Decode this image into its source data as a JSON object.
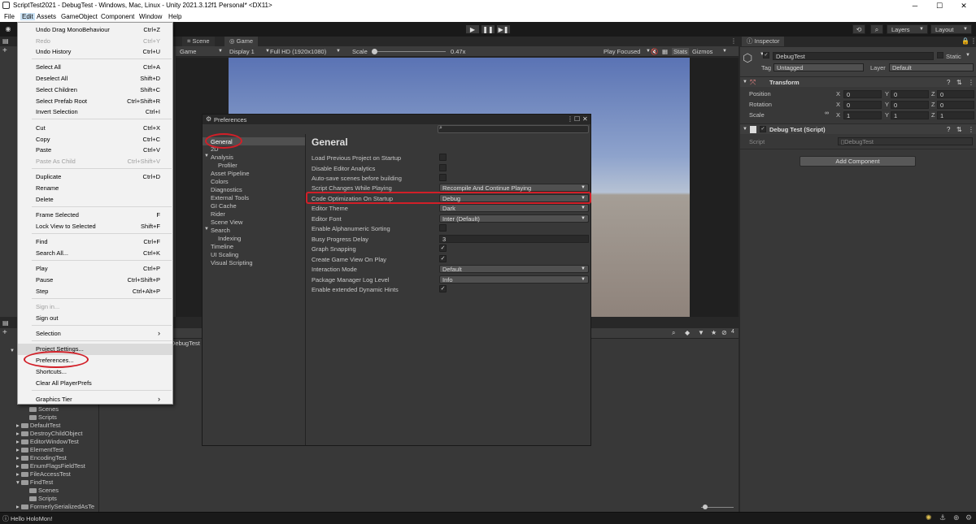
{
  "window": {
    "title": "ScriptTest2021 - DebugTest - Windows, Mac, Linux - Unity 2021.3.12f1 Personal* <DX11>",
    "minimize": "─",
    "maximize": "☐",
    "close": "✕"
  },
  "menubar": [
    "File",
    "Edit",
    "Assets",
    "GameObject",
    "Component",
    "Window",
    "Help"
  ],
  "edit_menu": {
    "items": [
      {
        "label": "Undo Drag MonoBehaviour",
        "shortcut": "Ctrl+Z"
      },
      {
        "label": "Redo",
        "shortcut": "Ctrl+Y",
        "disabled": true
      },
      {
        "label": "Undo History",
        "shortcut": "Ctrl+U"
      },
      {
        "label": "Select All",
        "shortcut": "Ctrl+A"
      },
      {
        "label": "Deselect All",
        "shortcut": "Shift+D"
      },
      {
        "label": "Select Children",
        "shortcut": "Shift+C"
      },
      {
        "label": "Select Prefab Root",
        "shortcut": "Ctrl+Shift+R"
      },
      {
        "label": "Invert Selection",
        "shortcut": "Ctrl+I"
      },
      {
        "label": "Cut",
        "shortcut": "Ctrl+X"
      },
      {
        "label": "Copy",
        "shortcut": "Ctrl+C"
      },
      {
        "label": "Paste",
        "shortcut": "Ctrl+V"
      },
      {
        "label": "Paste As Child",
        "shortcut": "Ctrl+Shift+V",
        "disabled": true
      },
      {
        "label": "Duplicate",
        "shortcut": "Ctrl+D"
      },
      {
        "label": "Rename",
        "shortcut": ""
      },
      {
        "label": "Delete",
        "shortcut": ""
      },
      {
        "label": "Frame Selected",
        "shortcut": "F"
      },
      {
        "label": "Lock View to Selected",
        "shortcut": "Shift+F"
      },
      {
        "label": "Find",
        "shortcut": "Ctrl+F"
      },
      {
        "label": "Search All...",
        "shortcut": "Ctrl+K"
      },
      {
        "label": "Play",
        "shortcut": "Ctrl+P"
      },
      {
        "label": "Pause",
        "shortcut": "Ctrl+Shift+P"
      },
      {
        "label": "Step",
        "shortcut": "Ctrl+Alt+P"
      },
      {
        "label": "Sign in...",
        "shortcut": "",
        "disabled": true
      },
      {
        "label": "Sign out",
        "shortcut": ""
      },
      {
        "label": "Selection",
        "shortcut": "›"
      },
      {
        "label": "Project Settings...",
        "shortcut": ""
      },
      {
        "label": "Preferences...",
        "shortcut": ""
      },
      {
        "label": "Shortcuts...",
        "shortcut": ""
      },
      {
        "label": "Clear All PlayerPrefs",
        "shortcut": ""
      },
      {
        "label": "Graphics Tier",
        "shortcut": "›"
      }
    ]
  },
  "toolbar": {
    "play": "▶",
    "pause": "❚❚",
    "step": "▶❚",
    "layers": "Layers",
    "layout": "Layout"
  },
  "scene_tabs": {
    "scene": "Scene",
    "game": "Game"
  },
  "game_bar": {
    "mode": "Game",
    "display": "Display 1",
    "resolution": "Full HD (1920x1080)",
    "scale_label": "Scale",
    "scale_value": "0.47x",
    "play_focused": "Play Focused",
    "stats": "Stats",
    "gizmos": "Gizmos"
  },
  "inspector": {
    "tab": "Inspector",
    "object_name": "DebugTest",
    "static_label": "Static",
    "tag_label": "Tag",
    "tag_value": "Untagged",
    "layer_label": "Layer",
    "layer_value": "Default",
    "transform_title": "Transform",
    "position_label": "Position",
    "rotation_label": "Rotation",
    "scale_label": "Scale",
    "axis_x": "X",
    "axis_y": "Y",
    "axis_z": "Z",
    "pos": [
      "0",
      "0",
      "0"
    ],
    "rot": [
      "0",
      "0",
      "0"
    ],
    "scl": [
      "1",
      "1",
      "1"
    ],
    "script_title": "Debug Test (Script)",
    "script_label": "Script",
    "script_value": "DebugTest",
    "add_component": "Add Component"
  },
  "preferences": {
    "title": "Preferences",
    "heading": "General",
    "sidebar": [
      "General",
      "2D",
      "Analysis",
      "Profiler",
      "Asset Pipeline",
      "Colors",
      "Diagnostics",
      "External Tools",
      "GI Cache",
      "Rider",
      "Scene View",
      "Search",
      "Indexing",
      "Timeline",
      "UI Scaling",
      "Visual Scripting"
    ],
    "rows": {
      "load_prev": "Load Previous Project on Startup",
      "disable_analytics": "Disable Editor Analytics",
      "autosave": "Auto-save scenes before building",
      "script_changes": "Script Changes While Playing",
      "script_changes_value": "Recompile And Continue Playing",
      "code_opt": "Code Optimization On Startup",
      "code_opt_value": "Debug",
      "theme": "Editor Theme",
      "theme_value": "Dark",
      "font": "Editor Font",
      "font_value": "Inter (Default)",
      "alpha_sort": "Enable Alphanumeric Sorting",
      "busy_delay": "Busy Progress Delay",
      "busy_delay_value": "3",
      "graph_snap": "Graph Snapping",
      "create_gv": "Create Game View On Play",
      "interaction": "Interaction Mode",
      "interaction_value": "Default",
      "pkg_log": "Package Manager Log Level",
      "pkg_log_value": "Info",
      "dyn_hints": "Enable extended Dynamic Hints"
    }
  },
  "project": {
    "tab_partial": "DebugTest",
    "tree": [
      "Scenes",
      "Scripts",
      "DefaultTest",
      "DestroyChildObject",
      "EditorWindowTest",
      "ElementTest",
      "EncodingTest",
      "EnumFlagsFieldTest",
      "FileAccessTest",
      "FindTest",
      "Scenes",
      "Scripts",
      "FormerlySerializedAsTe"
    ],
    "count": "4"
  },
  "status": {
    "message": "Hello HoloMon!"
  }
}
